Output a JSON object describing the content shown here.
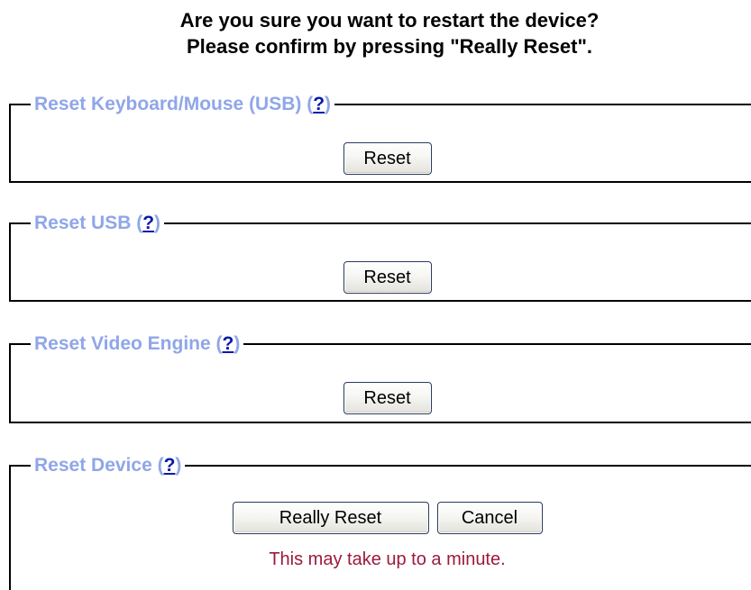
{
  "confirm": {
    "line1": "Are you sure you want to restart the device?",
    "line2": "Please confirm by pressing \"Really Reset\"."
  },
  "sections": {
    "keyboard_mouse": {
      "title": "Reset Keyboard/Mouse (USB)",
      "help": "?",
      "button": "Reset"
    },
    "usb": {
      "title": "Reset USB",
      "help": "?",
      "button": "Reset"
    },
    "video_engine": {
      "title": "Reset Video Engine",
      "help": "?",
      "button": "Reset"
    },
    "device": {
      "title": "Reset Device",
      "help": "?",
      "really_reset_button": "Really Reset",
      "cancel_button": "Cancel",
      "note": "This may take up to a minute."
    }
  },
  "colors": {
    "legend": "#8fa6e8",
    "help_link": "#0a1aa8",
    "note": "#9c1a3c"
  }
}
